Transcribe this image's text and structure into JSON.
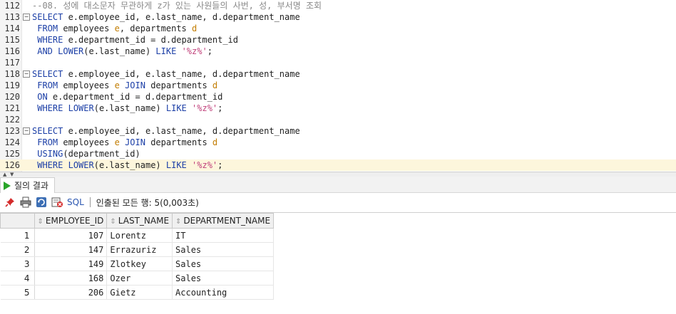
{
  "editor": {
    "lines": [
      {
        "n": "112",
        "tokens": [
          {
            "t": "--08. 성에 대소문자 무관하게 z가 있는 사원들의 사번, 성, 부서명 조회",
            "c": "cm"
          }
        ]
      },
      {
        "n": "113",
        "fold": "−",
        "tokens": [
          {
            "t": "SELECT",
            "c": "kw"
          },
          {
            "t": " e.employee_id, e.last_name, d.department_name",
            "c": "id"
          }
        ]
      },
      {
        "n": "114",
        "tokens": [
          {
            "t": " FROM",
            "c": "kw"
          },
          {
            "t": " employees ",
            "c": "id"
          },
          {
            "t": "e",
            "c": "al"
          },
          {
            "t": ", departments ",
            "c": "id"
          },
          {
            "t": "d",
            "c": "al"
          }
        ]
      },
      {
        "n": "115",
        "tokens": [
          {
            "t": " WHERE",
            "c": "kw"
          },
          {
            "t": " e.department_id = d.department_id",
            "c": "id"
          }
        ]
      },
      {
        "n": "116",
        "tokens": [
          {
            "t": " AND",
            "c": "kw"
          },
          {
            "t": " ",
            "c": "id"
          },
          {
            "t": "LOWER",
            "c": "kw"
          },
          {
            "t": "(e.last_name) ",
            "c": "id"
          },
          {
            "t": "LIKE",
            "c": "kw"
          },
          {
            "t": " ",
            "c": "id"
          },
          {
            "t": "'%z%'",
            "c": "str"
          },
          {
            "t": ";",
            "c": "id"
          }
        ]
      },
      {
        "n": "117",
        "tokens": []
      },
      {
        "n": "118",
        "fold": "−",
        "tokens": [
          {
            "t": "SELECT",
            "c": "kw"
          },
          {
            "t": " e.employee_id, e.last_name, d.department_name",
            "c": "id"
          }
        ]
      },
      {
        "n": "119",
        "tokens": [
          {
            "t": " FROM",
            "c": "kw"
          },
          {
            "t": " employees ",
            "c": "id"
          },
          {
            "t": "e",
            "c": "al"
          },
          {
            "t": " ",
            "c": "id"
          },
          {
            "t": "JOIN",
            "c": "kw"
          },
          {
            "t": " departments ",
            "c": "id"
          },
          {
            "t": "d",
            "c": "al"
          }
        ]
      },
      {
        "n": "120",
        "tokens": [
          {
            "t": " ON",
            "c": "kw"
          },
          {
            "t": " e.department_id = d.department_id",
            "c": "id"
          }
        ]
      },
      {
        "n": "121",
        "tokens": [
          {
            "t": " WHERE",
            "c": "kw"
          },
          {
            "t": " ",
            "c": "id"
          },
          {
            "t": "LOWER",
            "c": "kw"
          },
          {
            "t": "(e.last_name) ",
            "c": "id"
          },
          {
            "t": "LIKE",
            "c": "kw"
          },
          {
            "t": " ",
            "c": "id"
          },
          {
            "t": "'%z%'",
            "c": "str"
          },
          {
            "t": ";",
            "c": "id"
          }
        ]
      },
      {
        "n": "122",
        "tokens": []
      },
      {
        "n": "123",
        "fold": "−",
        "tokens": [
          {
            "t": "SELECT",
            "c": "kw"
          },
          {
            "t": " e.employee_id, e.last_name, d.department_name",
            "c": "id"
          }
        ]
      },
      {
        "n": "124",
        "tokens": [
          {
            "t": " FROM",
            "c": "kw"
          },
          {
            "t": " employees ",
            "c": "id"
          },
          {
            "t": "e",
            "c": "al"
          },
          {
            "t": " ",
            "c": "id"
          },
          {
            "t": "JOIN",
            "c": "kw"
          },
          {
            "t": " departments ",
            "c": "id"
          },
          {
            "t": "d",
            "c": "al"
          }
        ]
      },
      {
        "n": "125",
        "tokens": [
          {
            "t": " USING",
            "c": "kw"
          },
          {
            "t": "(department_id)",
            "c": "id"
          }
        ]
      },
      {
        "n": "126",
        "current": true,
        "tokens": [
          {
            "t": " WHERE",
            "c": "kw"
          },
          {
            "t": " ",
            "c": "id"
          },
          {
            "t": "LOWER",
            "c": "kw"
          },
          {
            "t": "(e.last_name) ",
            "c": "id"
          },
          {
            "t": "LIKE",
            "c": "kw"
          },
          {
            "t": " ",
            "c": "id"
          },
          {
            "t": "'%z%'",
            "c": "str"
          },
          {
            "t": ";",
            "c": "id"
          }
        ]
      }
    ]
  },
  "results": {
    "tab_label": "질의 결과",
    "sql_label": "SQL",
    "status": "인출된 모든 행: 5(0,003초)",
    "columns": [
      "EMPLOYEE_ID",
      "LAST_NAME",
      "DEPARTMENT_NAME"
    ],
    "rows": [
      {
        "rn": "1",
        "id": "107",
        "name": "Lorentz",
        "dept": "IT"
      },
      {
        "rn": "2",
        "id": "147",
        "name": "Errazuriz",
        "dept": "Sales"
      },
      {
        "rn": "3",
        "id": "149",
        "name": "Zlotkey",
        "dept": "Sales"
      },
      {
        "rn": "4",
        "id": "168",
        "name": "Ozer",
        "dept": "Sales"
      },
      {
        "rn": "5",
        "id": "206",
        "name": "Gietz",
        "dept": "Accounting"
      }
    ]
  },
  "icons": [
    "pin-icon",
    "print-icon",
    "refresh-icon",
    "export-icon",
    "run-icon"
  ]
}
